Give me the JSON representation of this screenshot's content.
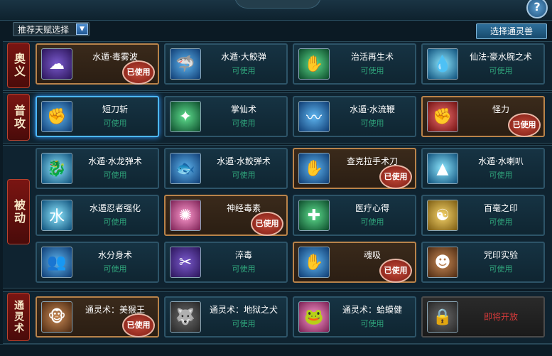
{
  "header": {
    "help_label": "?"
  },
  "controls": {
    "talent_select_label": "推荐天赋选择",
    "summon_button_label": "选择通灵兽"
  },
  "sections": [
    {
      "label": "奥义"
    },
    {
      "label": "普攻"
    },
    {
      "label": "被动"
    },
    {
      "label": "通灵术"
    }
  ],
  "skills": [
    {
      "name": "水遁·毒雾波",
      "status": "已使用",
      "icon": "poison-mist-icon",
      "used": true
    },
    {
      "name": "水遁·大鲛弹",
      "status": "可使用",
      "icon": "shark-icon",
      "used": false
    },
    {
      "name": "治活再生术",
      "status": "可使用",
      "icon": "healing-hand-icon",
      "used": false
    },
    {
      "name": "仙法·豪水腕之术",
      "status": "可使用",
      "icon": "water-arm-icon",
      "used": false
    },
    {
      "name": "短刀斩",
      "status": "可使用",
      "icon": "fist-icon",
      "used": false,
      "selected": true
    },
    {
      "name": "掌仙术",
      "status": "可使用",
      "icon": "palm-healing-icon",
      "used": false
    },
    {
      "name": "水遁·水流鞭",
      "status": "可使用",
      "icon": "water-whip-icon",
      "used": false
    },
    {
      "name": "怪力",
      "status": "已使用",
      "icon": "red-fist-icon",
      "used": true
    },
    {
      "name": "水遁·水龙弹术",
      "status": "可使用",
      "icon": "water-dragon-icon",
      "used": false
    },
    {
      "name": "水遁·水鲛弹术",
      "status": "可使用",
      "icon": "water-shark-icon",
      "used": false
    },
    {
      "name": "查克拉手术刀",
      "status": "已使用",
      "icon": "chakra-scalpel-icon",
      "used": true
    },
    {
      "name": "水遁·水喇叭",
      "status": "可使用",
      "icon": "water-spikes-icon",
      "used": false
    },
    {
      "name": "水遁忍者强化",
      "status": "可使用",
      "icon": "water-kanji-icon",
      "used": false
    },
    {
      "name": "神经毒素",
      "status": "已使用",
      "icon": "brain-icon",
      "used": true
    },
    {
      "name": "医疗心得",
      "status": "可使用",
      "icon": "medical-scroll-icon",
      "used": false
    },
    {
      "name": "百毫之印",
      "status": "可使用",
      "icon": "seal-face-icon",
      "used": false
    },
    {
      "name": "水分身术",
      "status": "可使用",
      "icon": "water-clone-icon",
      "used": false
    },
    {
      "name": "淬毒",
      "status": "可使用",
      "icon": "poison-blade-icon",
      "used": false
    },
    {
      "name": "魂吸",
      "status": "已使用",
      "icon": "soul-absorb-icon",
      "used": true
    },
    {
      "name": "咒印实验",
      "status": "可使用",
      "icon": "curse-mark-icon",
      "used": false
    },
    {
      "name": "通灵术：美猴王",
      "status": "已使用",
      "icon": "monkey-king-icon",
      "used": true
    },
    {
      "name": "通灵术：地狱之犬",
      "status": "可使用",
      "icon": "hell-dog-icon",
      "used": false
    },
    {
      "name": "通灵术：蛤蟆健",
      "status": "可使用",
      "icon": "toad-icon",
      "used": false
    },
    {
      "name": "即将开放",
      "status": "",
      "icon": "lock-icon",
      "locked": true
    }
  ]
}
